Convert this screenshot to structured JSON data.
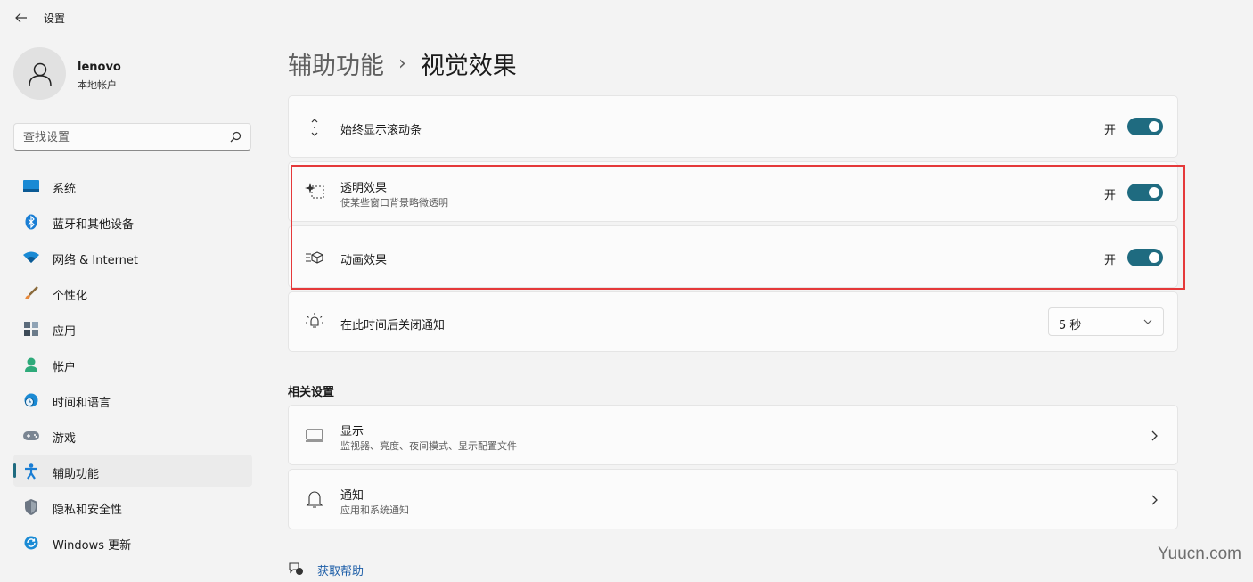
{
  "app": {
    "title": "设置"
  },
  "profile": {
    "name": "lenovo",
    "account_type": "本地帐户"
  },
  "search": {
    "placeholder": "查找设置"
  },
  "sidebar": {
    "items": [
      {
        "label": "系统",
        "icon": "system-icon"
      },
      {
        "label": "蓝牙和其他设备",
        "icon": "bluetooth-icon"
      },
      {
        "label": "网络 & Internet",
        "icon": "wifi-icon"
      },
      {
        "label": "个性化",
        "icon": "brush-icon"
      },
      {
        "label": "应用",
        "icon": "apps-icon"
      },
      {
        "label": "帐户",
        "icon": "account-icon"
      },
      {
        "label": "时间和语言",
        "icon": "clock-globe-icon"
      },
      {
        "label": "游戏",
        "icon": "gamepad-icon"
      },
      {
        "label": "辅助功能",
        "icon": "accessibility-icon",
        "active": true
      },
      {
        "label": "隐私和安全性",
        "icon": "shield-icon"
      },
      {
        "label": "Windows 更新",
        "icon": "update-icon"
      }
    ]
  },
  "breadcrumb": {
    "parent": "辅助功能",
    "separator": "›",
    "current": "视觉效果"
  },
  "settings": {
    "scrollbars": {
      "title": "始终显示滚动条",
      "state_label": "开",
      "on": true
    },
    "transparency": {
      "title": "透明效果",
      "subtitle": "使某些窗口背景略微透明",
      "state_label": "开",
      "on": true
    },
    "animation": {
      "title": "动画效果",
      "state_label": "开",
      "on": true
    },
    "notifications": {
      "title": "在此时间后关闭通知",
      "selected": "5 秒"
    }
  },
  "related": {
    "heading": "相关设置",
    "display": {
      "title": "显示",
      "subtitle": "监视器、亮度、夜间模式、显示配置文件"
    },
    "notify": {
      "title": "通知",
      "subtitle": "应用和系统通知"
    }
  },
  "help": {
    "label": "获取帮助"
  },
  "watermark": "Yuucn.com",
  "colors": {
    "accent": "#1f6b80",
    "highlight_border": "#e5393a",
    "link": "#1f5fa8"
  }
}
